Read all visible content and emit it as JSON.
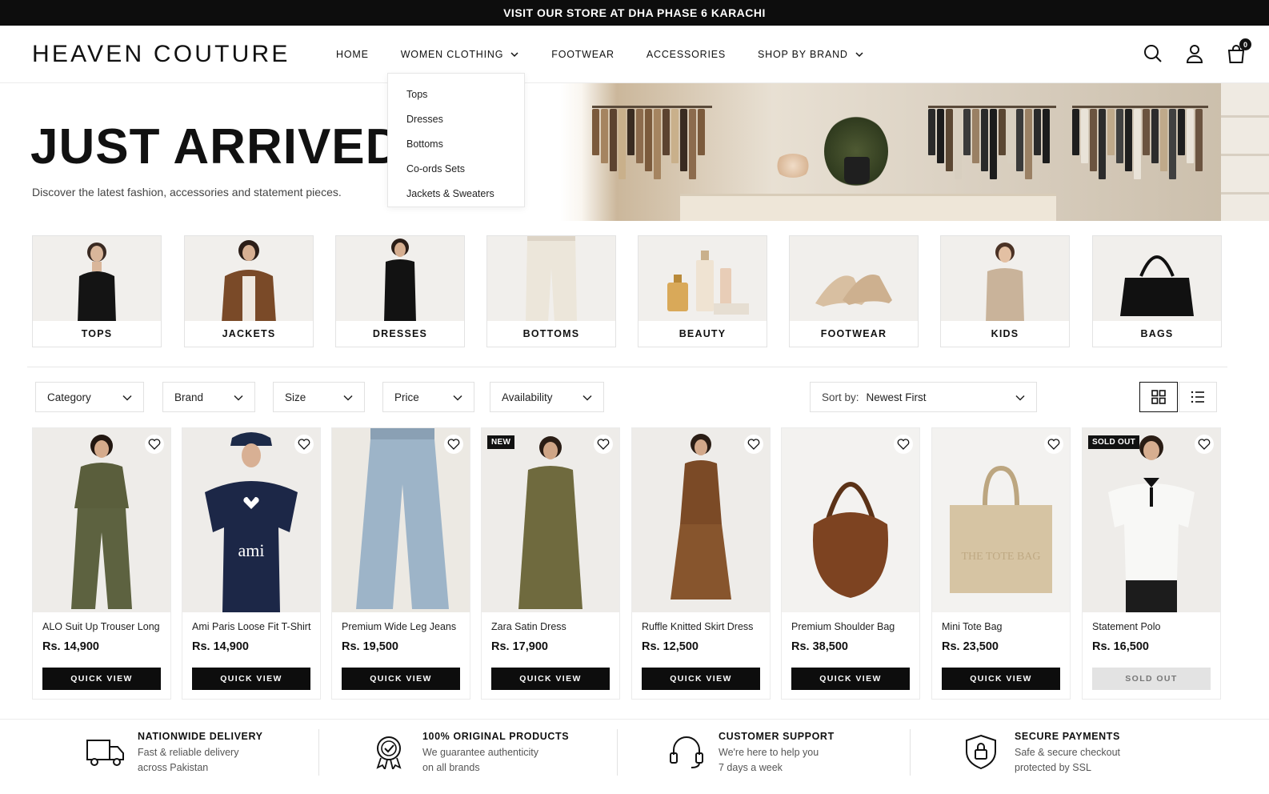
{
  "announcement": "VISIT OUR STORE AT DHA PHASE 6 KARACHI",
  "brand": "HEAVEN COUTURE",
  "nav": {
    "home": "HOME",
    "women": "WOMEN CLOTHING",
    "footwear": "FOOTWEAR",
    "accessories": "ACCESSORIES",
    "brand": "SHOP BY BRAND"
  },
  "cart_count": "0",
  "dropdown": [
    "Tops",
    "Dresses",
    "Bottoms",
    "Co-ords Sets",
    "Jackets & Sweaters"
  ],
  "hero": {
    "title": "JUST ARRIVED",
    "subtitle": "Discover the latest fashion, accessories and statement pieces."
  },
  "categories": [
    "TOPS",
    "JACKETS",
    "DRESSES",
    "BOTTOMS",
    "BEAUTY",
    "FOOTWEAR",
    "KIDS",
    "BAGS"
  ],
  "filters": {
    "category": "Category",
    "brand": "Brand",
    "size": "Size",
    "price": "Price",
    "availability": "Availability",
    "sort_label": "Sort by:",
    "sort_value": "Newest First"
  },
  "products": [
    {
      "name": "ALO Suit Up Trouser Long",
      "price": "Rs. 14,900",
      "action": "QUICK VIEW",
      "badge": ""
    },
    {
      "name": "Ami Paris Loose Fit T-Shirt",
      "price": "Rs. 14,900",
      "action": "QUICK VIEW",
      "badge": "",
      "print": "ami"
    },
    {
      "name": "Premium Wide Leg Jeans",
      "price": "Rs. 19,500",
      "action": "QUICK VIEW",
      "badge": ""
    },
    {
      "name": "Zara Satin Dress",
      "price": "Rs. 17,900",
      "action": "QUICK VIEW",
      "badge": "NEW"
    },
    {
      "name": "Ruffle Knitted Skirt Dress",
      "price": "Rs. 12,500",
      "action": "QUICK VIEW",
      "badge": ""
    },
    {
      "name": "Premium Shoulder Bag",
      "price": "Rs. 38,500",
      "action": "QUICK VIEW",
      "badge": ""
    },
    {
      "name": "Mini Tote Bag",
      "price": "Rs. 23,500",
      "action": "QUICK VIEW",
      "badge": "",
      "print": "THE TOTE BAG"
    },
    {
      "name": "Statement Polo",
      "price": "Rs. 16,500",
      "action": "SOLD OUT",
      "badge": "SOLD OUT"
    }
  ],
  "features": [
    {
      "title": "NATIONWIDE DELIVERY",
      "line1": "Fast & reliable delivery",
      "line2": "across Pakistan",
      "icon": "truck-icon"
    },
    {
      "title": "100% ORIGINAL PRODUCTS",
      "line1": "We guarantee authenticity",
      "line2": "on all brands",
      "icon": "badge-check-icon"
    },
    {
      "title": "CUSTOMER SUPPORT",
      "line1": "We're here to help you",
      "line2": "7 days a week",
      "icon": "headset-icon"
    },
    {
      "title": "SECURE PAYMENTS",
      "line1": "Safe & secure checkout",
      "line2": "protected by SSL",
      "icon": "shield-lock-icon"
    }
  ],
  "colors": {
    "accent": "#0d0d0d",
    "sold_out": "#e3e3e3",
    "border": "#e3e3e3"
  }
}
